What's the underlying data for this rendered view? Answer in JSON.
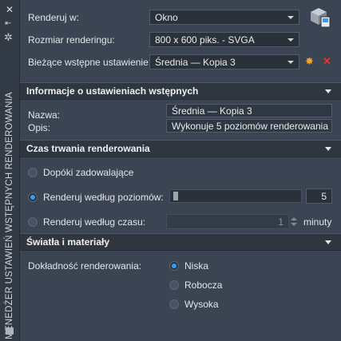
{
  "palette": {
    "title": "MENEDŻER USTAWIEŃ WSTĘPNYCH RENDEROWANIA"
  },
  "top": {
    "render_in_label": "Renderuj w:",
    "render_in_value": "Okno",
    "render_size_label": "Rozmiar renderingu:",
    "render_size_value": "800 x 600 piks. - SVGA",
    "current_preset_label": "Bieżące wstępne ustawienie:",
    "current_preset_value": "Średnia — Kopia 3"
  },
  "preset_info": {
    "header": "Informacje o ustawieniach wstępnych",
    "name_label": "Nazwa:",
    "name_value": "Średnia — Kopia 3",
    "desc_label": "Opis:",
    "desc_value": "Wykonuje 5 poziomów renderowania"
  },
  "duration": {
    "header": "Czas trwania renderowania",
    "opt_until": "Dopóki zadowalające",
    "opt_levels": "Renderuj według poziomów:",
    "levels_value": "5",
    "opt_time": "Renderuj według czasu:",
    "time_value": "1",
    "time_unit": "minuty",
    "selected": "levels"
  },
  "lights": {
    "header": "Światła i materiały",
    "accuracy_label": "Dokładność renderowania:",
    "opt_low": "Niska",
    "opt_draft": "Robocza",
    "opt_high": "Wysoka",
    "selected": "low"
  }
}
